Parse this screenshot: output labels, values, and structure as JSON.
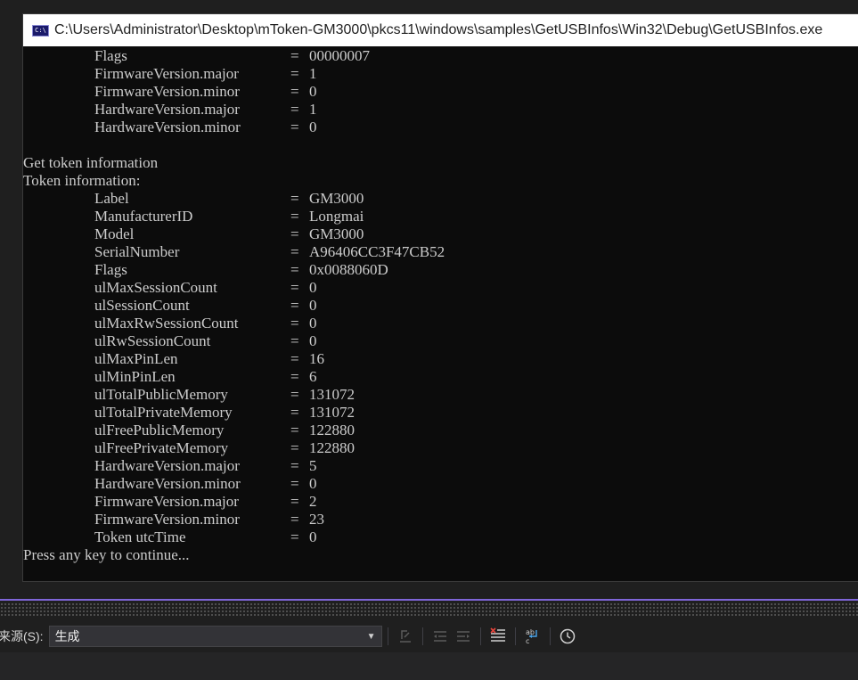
{
  "window": {
    "icon_text": "C:\\",
    "title": "C:\\Users\\Administrator\\Desktop\\mToken-GM3000\\pkcs11\\windows\\samples\\GetUSBInfos\\Win32\\Debug\\GetUSBInfos.exe"
  },
  "console": {
    "top_fields": [
      {
        "key": "Flags",
        "value": "00000007"
      },
      {
        "key": "FirmwareVersion.major",
        "value": "1"
      },
      {
        "key": "FirmwareVersion.minor",
        "value": "0"
      },
      {
        "key": "HardwareVersion.major",
        "value": "1"
      },
      {
        "key": "HardwareVersion.minor",
        "value": "0"
      }
    ],
    "get_token_line": "Get token information",
    "token_header": "Token information:",
    "token_fields": [
      {
        "key": "Label",
        "value": "GM3000"
      },
      {
        "key": "ManufacturerID",
        "value": "Longmai"
      },
      {
        "key": "Model",
        "value": "GM3000"
      },
      {
        "key": "SerialNumber",
        "value": "A96406CC3F47CB52"
      },
      {
        "key": "Flags",
        "value": "0x0088060D"
      },
      {
        "key": "ulMaxSessionCount",
        "value": "0"
      },
      {
        "key": "ulSessionCount",
        "value": "0"
      },
      {
        "key": "ulMaxRwSessionCount",
        "value": "0"
      },
      {
        "key": "ulRwSessionCount",
        "value": "0"
      },
      {
        "key": "ulMaxPinLen",
        "value": "16"
      },
      {
        "key": "ulMinPinLen",
        "value": "6"
      },
      {
        "key": "ulTotalPublicMemory",
        "value": "131072"
      },
      {
        "key": "ulTotalPrivateMemory",
        "value": "131072"
      },
      {
        "key": "ulFreePublicMemory",
        "value": "122880"
      },
      {
        "key": "ulFreePrivateMemory",
        "value": "122880"
      },
      {
        "key": "HardwareVersion.major",
        "value": "5"
      },
      {
        "key": "HardwareVersion.minor",
        "value": "0"
      },
      {
        "key": "FirmwareVersion.major",
        "value": "2"
      },
      {
        "key": "FirmwareVersion.minor",
        "value": "23"
      },
      {
        "key": "Token utcTime",
        "value": "0"
      }
    ],
    "eq": "=",
    "prompt": "Press any key to continue..."
  },
  "output_toolbar": {
    "source_label": "来源(S):",
    "source_value": "生成",
    "buttons": [
      {
        "name": "find-message-in-code-button",
        "icon": "find-in-code-icon",
        "enabled": false
      },
      {
        "name": "previous-message-button",
        "icon": "previous-message-icon",
        "enabled": false
      },
      {
        "name": "next-message-button",
        "icon": "next-message-icon",
        "enabled": false
      },
      {
        "name": "clear-all-button",
        "icon": "clear-all-icon",
        "enabled": true
      },
      {
        "name": "toggle-word-wrap-button",
        "icon": "word-wrap-icon",
        "enabled": true
      },
      {
        "name": "show-timestamps-button",
        "icon": "clock-icon",
        "enabled": true
      }
    ]
  },
  "colors": {
    "console_bg": "#0c0c0c",
    "console_text": "#cccccc",
    "ide_bg": "#1f1f1f",
    "accent": "#7f66d8"
  }
}
